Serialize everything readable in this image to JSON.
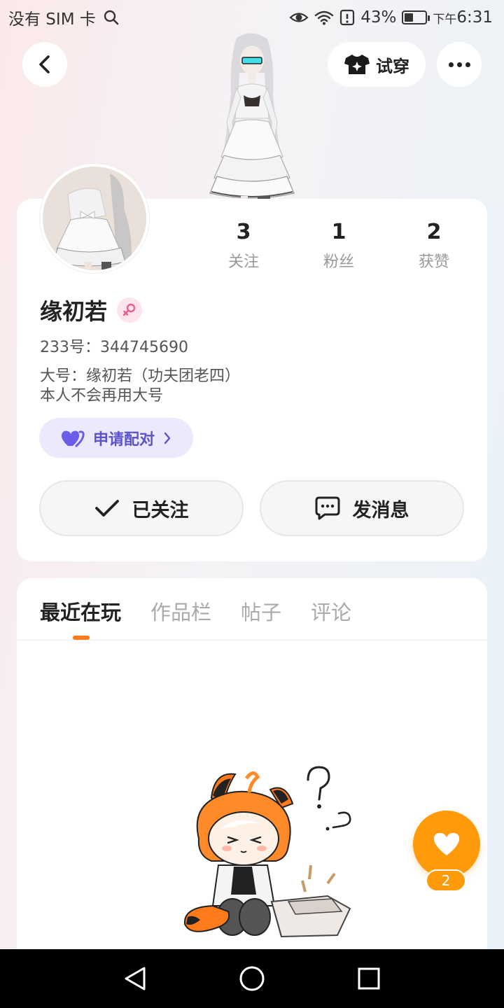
{
  "status_bar": {
    "carrier": "没有 SIM 卡",
    "battery": "43%",
    "battery_level": 0.43,
    "time_prefix": "下午",
    "time": "6:31"
  },
  "header": {
    "tryon_label": "试穿"
  },
  "profile": {
    "stats": [
      {
        "value": "3",
        "label": "关注"
      },
      {
        "value": "1",
        "label": "粉丝"
      },
      {
        "value": "2",
        "label": "获赞"
      }
    ],
    "username": "缘初若",
    "gender": "female",
    "user_id": "233号：344745690",
    "bio": "大号：缘初若（功夫团老四）\n本人不会再用大号",
    "pair_label": "申请配对",
    "follow_label": "已关注",
    "message_label": "发消息"
  },
  "tabs": [
    {
      "label": "最近在玩",
      "active": true
    },
    {
      "label": "作品栏",
      "active": false
    },
    {
      "label": "帖子",
      "active": false
    },
    {
      "label": "评论",
      "active": false
    }
  ],
  "like": {
    "count": "2"
  },
  "colors": {
    "accent": "#ff7a1a",
    "like": "#ff9a0b",
    "pair": "#5b54cf",
    "pair_bg": "#ebe9fb",
    "gender_pink": "#e85d8c"
  }
}
